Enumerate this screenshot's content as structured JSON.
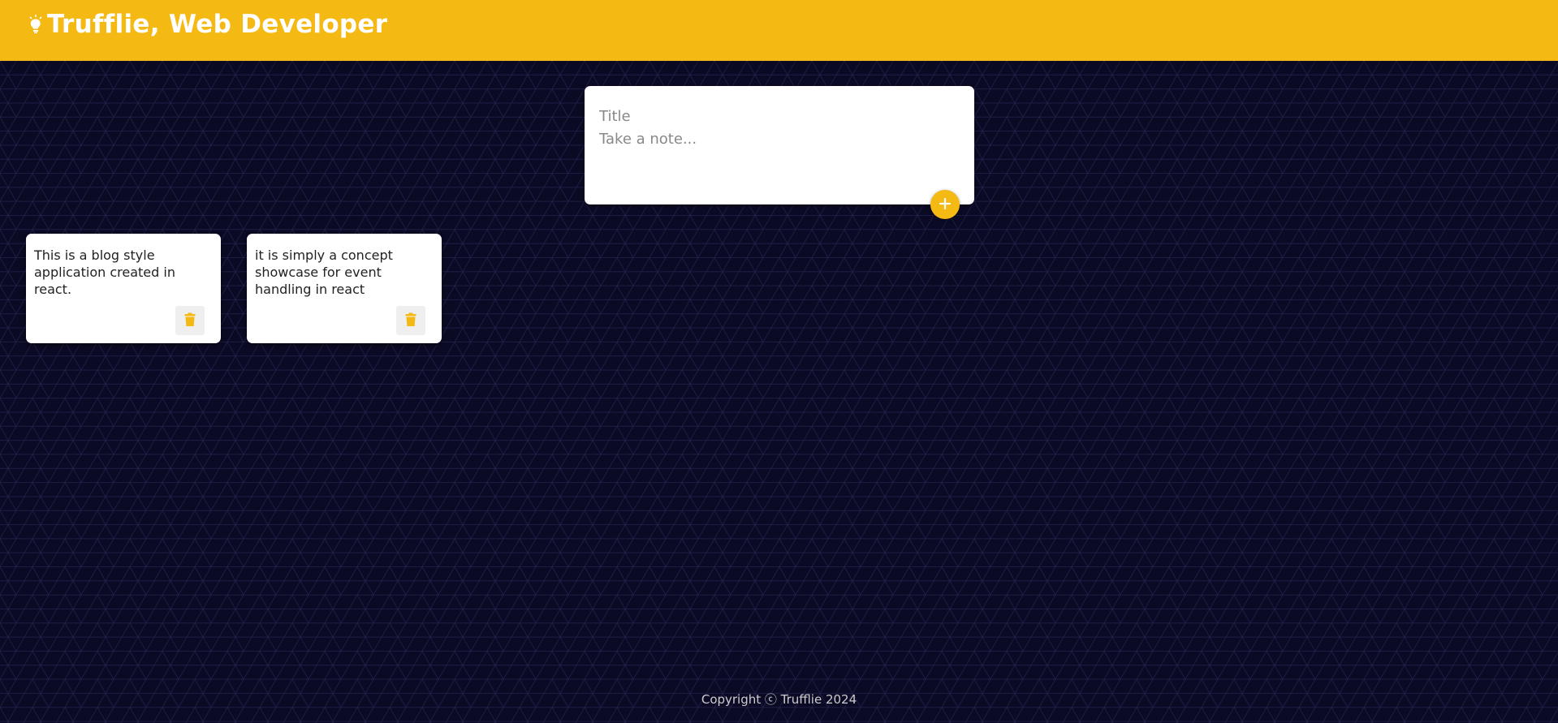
{
  "header": {
    "title": "Trufflie, Web Developer",
    "icon": "lightbulb-icon"
  },
  "create_note": {
    "title_placeholder": "Title",
    "content_placeholder": "Take a note...",
    "add_icon": "plus-icon"
  },
  "notes": [
    {
      "title": "",
      "content": "This is a blog style application created in react.",
      "delete_icon": "trash-icon"
    },
    {
      "title": "",
      "content": "it is simply a concept showcase for event handling in react",
      "delete_icon": "trash-icon"
    }
  ],
  "footer": {
    "copyright": "Copyright ⓒ Trufflie 2024"
  },
  "colors": {
    "accent": "#f5b914",
    "background": "#0b0a24",
    "card": "#ffffff",
    "delete_bg": "#efefef"
  }
}
